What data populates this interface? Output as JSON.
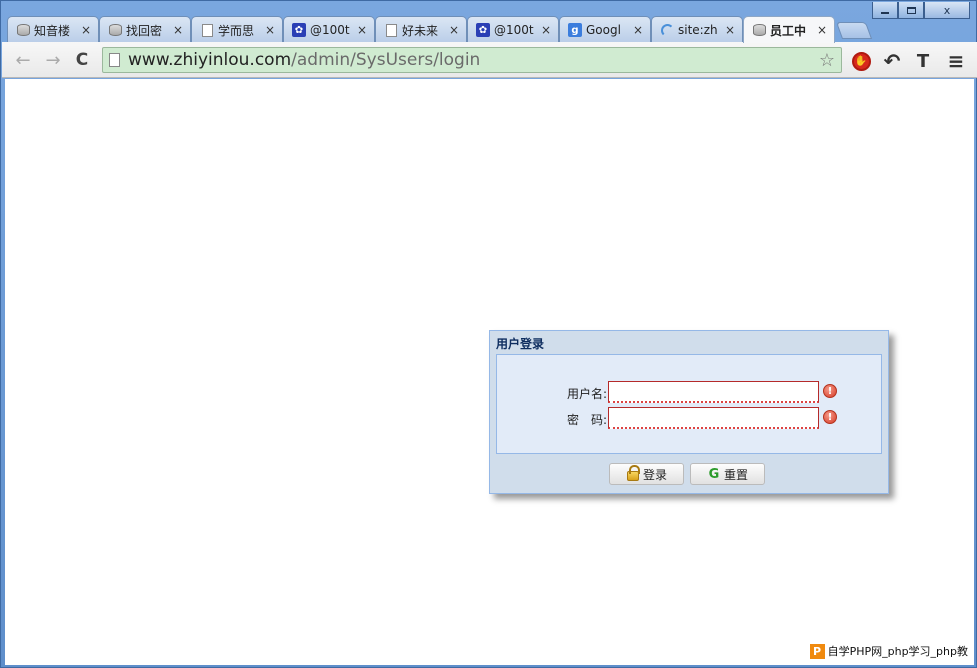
{
  "window": {
    "minimize_glyph": "",
    "maximize_glyph": "",
    "close_glyph": "x"
  },
  "tabs": [
    {
      "title": "知音楼",
      "icon": "database-icon"
    },
    {
      "title": "找回密",
      "icon": "database-icon"
    },
    {
      "title": "学而思",
      "icon": "page-icon"
    },
    {
      "title": "@100t",
      "icon": "paw-icon"
    },
    {
      "title": "好未来",
      "icon": "page-icon"
    },
    {
      "title": "@100t",
      "icon": "paw-icon"
    },
    {
      "title": "Googl",
      "icon": "google-icon"
    },
    {
      "title": "site:zh",
      "icon": "spinner-icon"
    },
    {
      "title": "员工中",
      "icon": "database-icon",
      "active": true
    }
  ],
  "tab_close_glyph": "×",
  "toolbar": {
    "back_glyph": "←",
    "forward_glyph": "→",
    "reload_glyph": "C",
    "url_host": "www.zhiyinlou.com",
    "url_path": "/admin/SysUsers/login",
    "star_glyph": "☆",
    "ext_undo_glyph": "↶",
    "ext_t_glyph": "T",
    "menu_glyph": "≡"
  },
  "dialog": {
    "title": "用户登录",
    "username_label": "用户名:",
    "password_label": "密　码:",
    "username_value": "",
    "password_value": "",
    "error_glyph": "!",
    "login_button": "登录",
    "reset_button": "重置",
    "reset_glyph": "G"
  },
  "watermark": {
    "logo": "P",
    "text": "自学PHP网_php学习_php教"
  }
}
